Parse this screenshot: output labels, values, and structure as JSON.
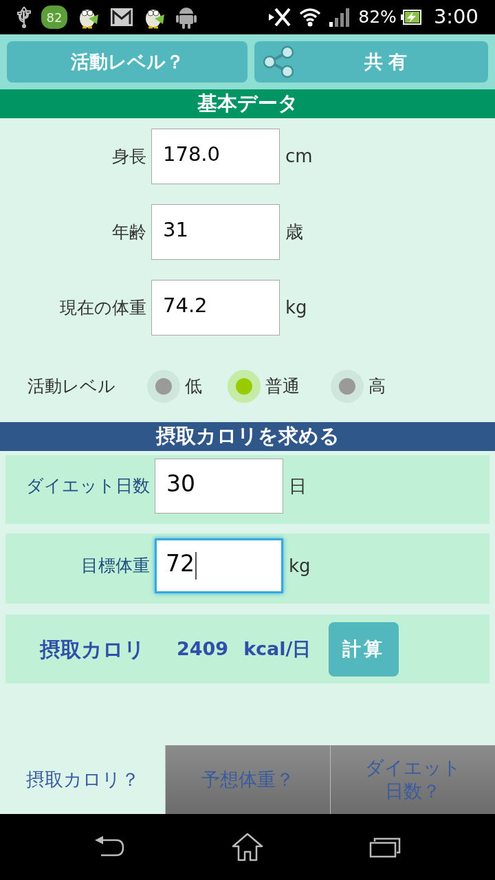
{
  "status_bar": {
    "badge": "82",
    "battery": "82%",
    "time": "3:00"
  },
  "top_buttons": [
    {
      "kind": "plain",
      "label": "活動レベル？"
    },
    {
      "kind": "share",
      "label": "共有"
    }
  ],
  "basic_data": {
    "title": "基本データ",
    "fields": [
      {
        "label": "身長",
        "value": "178.0",
        "unit": "cm"
      },
      {
        "label": "年齢",
        "value": "31",
        "unit": "歳"
      },
      {
        "label": "現在の体重",
        "value": "74.2",
        "unit": "kg"
      }
    ],
    "activity": {
      "label": "活動レベル",
      "options": [
        {
          "label": "低",
          "selected": false
        },
        {
          "label": "普通",
          "selected": true
        },
        {
          "label": "高",
          "selected": false
        }
      ]
    }
  },
  "calorie_section": {
    "title": "摂取カロリを求める",
    "fields": [
      {
        "label": "ダイエット日数",
        "value": "30",
        "unit": "日",
        "focused": false
      },
      {
        "label": "目標体重",
        "value": "72",
        "unit": "kg",
        "focused": true
      }
    ],
    "result": {
      "label": "摂取カロリ",
      "value": "2409",
      "unit": "kcal/日",
      "button": "計算"
    }
  },
  "bottom_tabs": [
    {
      "label": "摂取カロリ？",
      "selected": true
    },
    {
      "label": "予想体重？",
      "selected": false
    },
    {
      "label": "ダイエット日数？",
      "selected": false
    }
  ]
}
